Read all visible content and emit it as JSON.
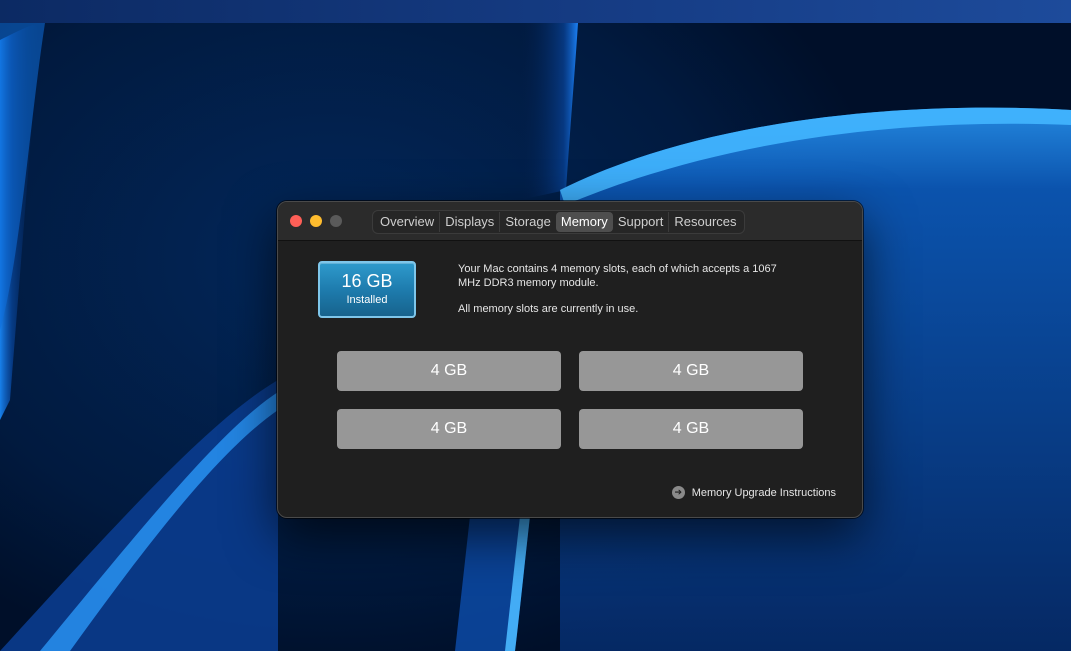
{
  "window": {
    "tabs": [
      {
        "label": "Overview"
      },
      {
        "label": "Displays"
      },
      {
        "label": "Storage"
      },
      {
        "label": "Memory",
        "active": true
      },
      {
        "label": "Support"
      },
      {
        "label": "Resources"
      }
    ]
  },
  "memory": {
    "installed_size": "16 GB",
    "installed_label": "Installed",
    "description_line1": "Your Mac contains 4 memory slots, each of which accepts a 1067 MHz DDR3 memory module.",
    "description_line2": "All memory slots are currently in use.",
    "slots": [
      "4 GB",
      "4 GB",
      "4 GB",
      "4 GB"
    ],
    "upgrade_link": "Memory Upgrade Instructions"
  },
  "icons": {
    "close": "close-dot",
    "minimize": "minimize-dot",
    "zoom": "zoom-dot",
    "upgrade": "arrow-right-circle-icon"
  },
  "colors": {
    "accent_blue": "#1e7cae",
    "slot_gray": "#979797",
    "window_bg": "#1f1f1f"
  }
}
